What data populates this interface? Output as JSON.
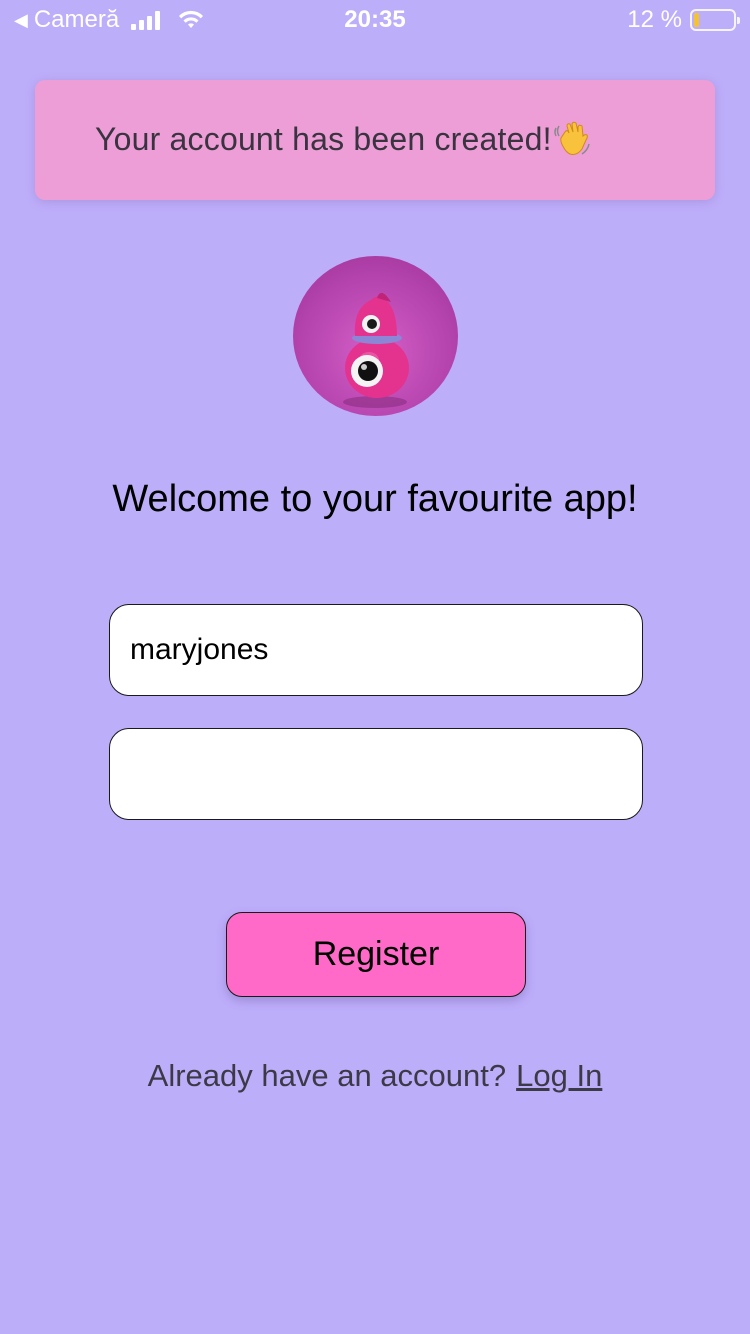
{
  "status_bar": {
    "back_symbol": "◀",
    "carrier": "Cameră",
    "time": "20:35",
    "battery_text": "12 %",
    "battery_level": 0.12
  },
  "toast": {
    "message": "Your account has been created!",
    "icon": "waving-hand-icon"
  },
  "avatar": {
    "icon": "pink-creature-avatar"
  },
  "welcome": {
    "title": "Welcome to your favourite app!"
  },
  "form": {
    "username_value": "maryjones",
    "password_value": "",
    "register_label": "Register"
  },
  "footer": {
    "prompt": "Already have an account?",
    "login_label": "Log In"
  },
  "colors": {
    "background": "#bdaefa",
    "toast": "#ed9ed7",
    "register_button": "#ff6ac8"
  }
}
